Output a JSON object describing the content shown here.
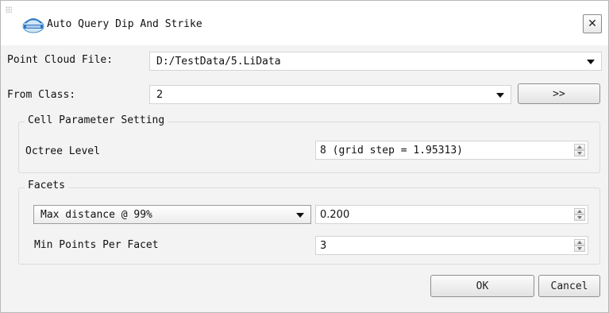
{
  "window": {
    "title": "Auto Query Dip And Strike",
    "close_label": "✕",
    "logo_icon": "app-logo-icon"
  },
  "point_cloud": {
    "label": "Point Cloud File:",
    "value": "D:/TestData/5.LiData"
  },
  "from_class": {
    "label": "From Class:",
    "value": "2",
    "next_label": ">>"
  },
  "cell_parameter": {
    "group_title": "Cell Parameter Setting",
    "octree_label": "Octree Level",
    "octree_value": "8 (grid step = 1.95313)"
  },
  "facets": {
    "group_title": "Facets",
    "distance_mode": "Max distance @ 99%",
    "distance_value": "0.200",
    "min_points_label": "Min Points Per Facet",
    "min_points_value": "3"
  },
  "buttons": {
    "ok": "OK",
    "cancel": "Cancel"
  }
}
